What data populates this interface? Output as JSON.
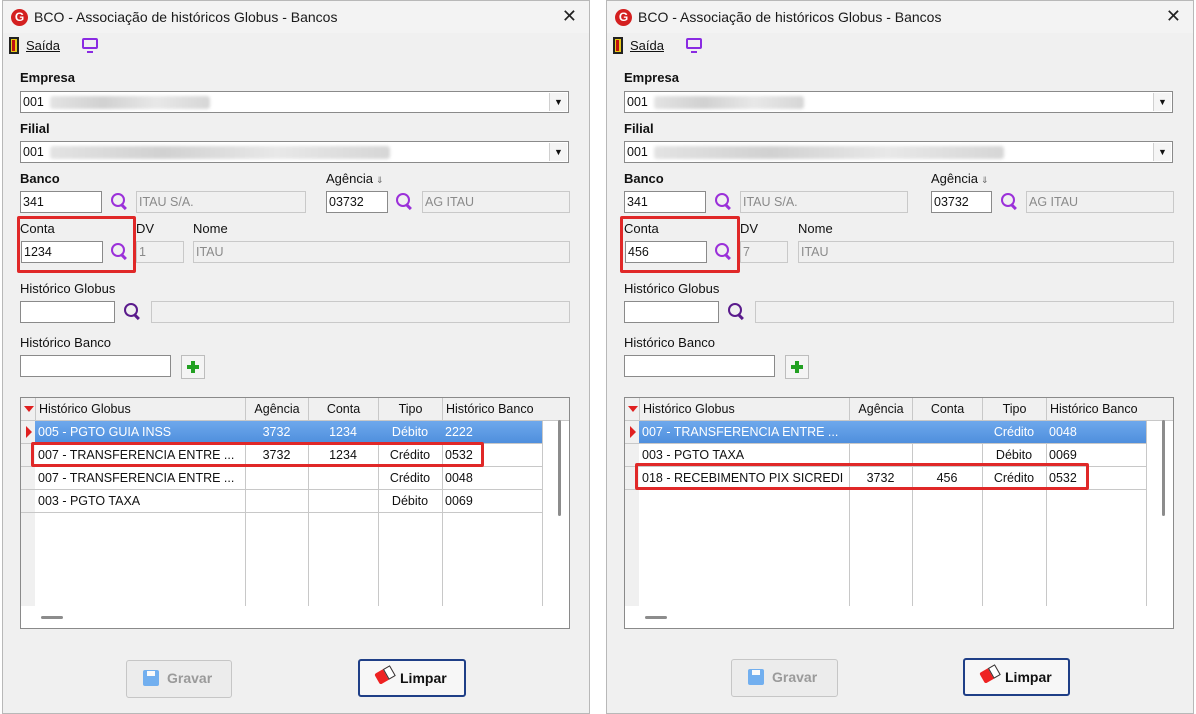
{
  "windows": [
    {
      "title": "BCO - Associação de históricos Globus - Bancos",
      "toolbar": {
        "exit_label": "Saída",
        "exit_icon": "exit-door-icon",
        "screen_icon": "monitor-icon"
      },
      "empresa": {
        "label": "Empresa",
        "value": "001"
      },
      "filial": {
        "label": "Filial",
        "value": "001"
      },
      "banco": {
        "label": "Banco",
        "code": "341",
        "name": "ITAU S/A."
      },
      "agencia": {
        "label": "Agência",
        "code": "03732",
        "name": "AG ITAU"
      },
      "conta": {
        "label": "Conta",
        "value": "1234"
      },
      "dv": {
        "label": "DV",
        "value": "1"
      },
      "nome": {
        "label": "Nome",
        "value": "ITAU"
      },
      "historico_globus": {
        "label": "Histórico Globus",
        "value": "",
        "description": ""
      },
      "historico_banco": {
        "label": "Histórico Banco",
        "value": ""
      },
      "grid": {
        "columns": [
          "Histórico Globus",
          "Agência",
          "Conta",
          "Tipo",
          "Histórico Banco"
        ],
        "rows": [
          {
            "historico": "005 - PGTO GUIA INSS",
            "agencia": "3732",
            "conta": "1234",
            "tipo": "Débito",
            "banco": "2222",
            "selected": true
          },
          {
            "historico": "007 - TRANSFERENCIA ENTRE ...",
            "agencia": "3732",
            "conta": "1234",
            "tipo": "Crédito",
            "banco": "0532"
          },
          {
            "historico": "007 - TRANSFERENCIA ENTRE ...",
            "agencia": "",
            "conta": "",
            "tipo": "Crédito",
            "banco": "0048"
          },
          {
            "historico": "003 - PGTO TAXA",
            "agencia": "",
            "conta": "",
            "tipo": "Débito",
            "banco": "0069"
          }
        ]
      },
      "buttons": {
        "save": "Gravar",
        "clear": "Limpar"
      }
    },
    {
      "title": "BCO - Associação de históricos Globus - Bancos",
      "toolbar": {
        "exit_label": "Saída",
        "exit_icon": "exit-door-icon",
        "screen_icon": "monitor-icon"
      },
      "empresa": {
        "label": "Empresa",
        "value": "001"
      },
      "filial": {
        "label": "Filial",
        "value": "001"
      },
      "banco": {
        "label": "Banco",
        "code": "341",
        "name": "ITAU S/A."
      },
      "agencia": {
        "label": "Agência",
        "code": "03732",
        "name": "AG ITAU"
      },
      "conta": {
        "label": "Conta",
        "value": "456"
      },
      "dv": {
        "label": "DV",
        "value": "7"
      },
      "nome": {
        "label": "Nome",
        "value": "ITAU"
      },
      "historico_globus": {
        "label": "Histórico Globus",
        "value": "",
        "description": ""
      },
      "historico_banco": {
        "label": "Histórico Banco",
        "value": ""
      },
      "grid": {
        "columns": [
          "Histórico Globus",
          "Agência",
          "Conta",
          "Tipo",
          "Histórico Banco"
        ],
        "rows": [
          {
            "historico": "007 - TRANSFERENCIA ENTRE ...",
            "agencia": "",
            "conta": "",
            "tipo": "Crédito",
            "banco": "0048",
            "selected": true
          },
          {
            "historico": "003 - PGTO TAXA",
            "agencia": "",
            "conta": "",
            "tipo": "Débito",
            "banco": "0069"
          },
          {
            "historico": "018 - RECEBIMENTO PIX SICREDI",
            "agencia": "3732",
            "conta": "456",
            "tipo": "Crédito",
            "banco": "0532"
          }
        ]
      },
      "buttons": {
        "save": "Gravar",
        "clear": "Limpar"
      }
    }
  ],
  "colors": {
    "highlight_box": "#e02828",
    "selected_row": "#5b9be6",
    "search_icon": "#9b30d9",
    "add_icon": "#22a022"
  }
}
